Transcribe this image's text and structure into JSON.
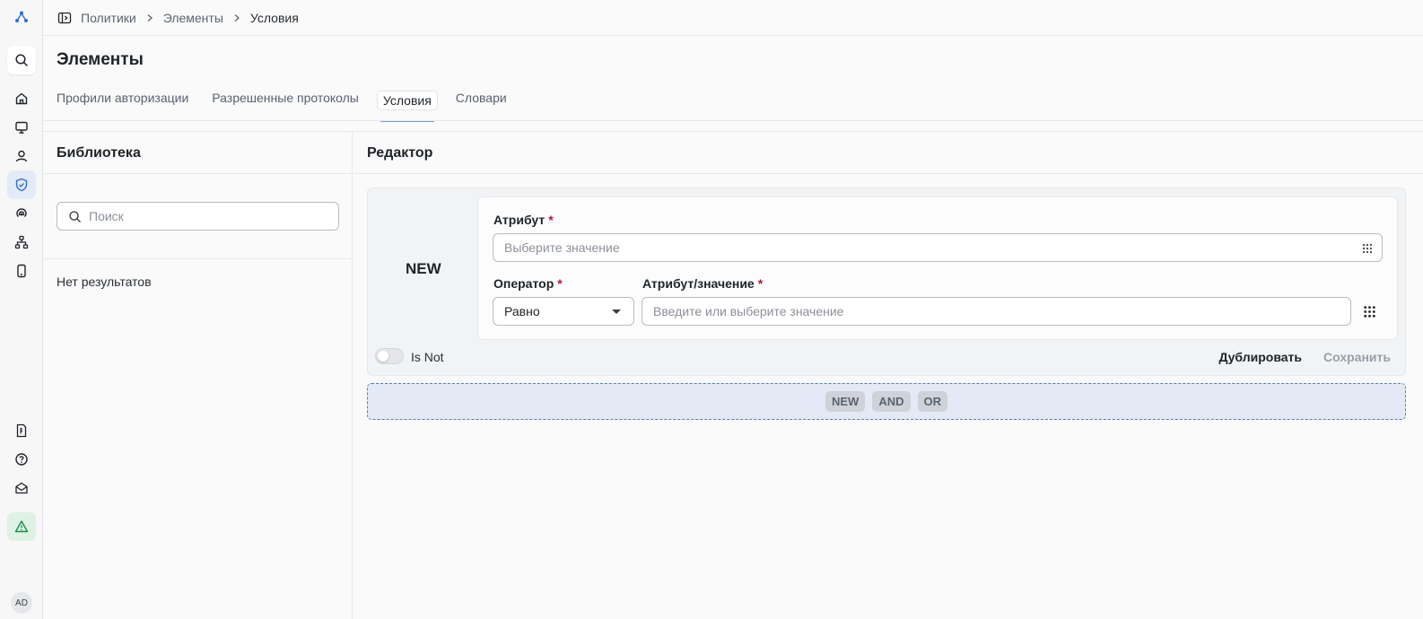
{
  "breadcrumb": [
    "Политики",
    "Элементы",
    "Условия"
  ],
  "page": {
    "title": "Элементы"
  },
  "tabs": [
    {
      "label": "Профили авторизации",
      "active": false
    },
    {
      "label": "Разрешенные протоколы",
      "active": false
    },
    {
      "label": "Условия",
      "active": true
    },
    {
      "label": "Словари",
      "active": false
    }
  ],
  "library": {
    "title": "Библиотека",
    "search_placeholder": "Поиск",
    "empty_text": "Нет результатов"
  },
  "editor": {
    "title": "Редактор",
    "condition_label": "NEW",
    "attribute_label": "Атрибут",
    "attribute_placeholder": "Выберите значение",
    "operator_label": "Оператор",
    "operator_value": "Равно",
    "value_label": "Атрибут/значение",
    "value_placeholder": "Введите или выберите значение",
    "required_mark": "*",
    "is_not_label": "Is Not",
    "is_not_enabled": false,
    "duplicate_label": "Дублировать",
    "save_label": "Сохранить",
    "chips": [
      "NEW",
      "AND",
      "OR"
    ]
  },
  "user": {
    "initials": "AD"
  },
  "colors": {
    "accent": "#2f6fd0",
    "active_tab_underline": "#7f9ed0",
    "required": "#b01a3a",
    "warning_bg": "#ddf2e3",
    "warning_icon": "#1f8a4c"
  },
  "icons": [
    "logo-icon",
    "search-icon",
    "home-icon",
    "monitor-icon",
    "user-icon",
    "shield-check-icon",
    "broadcast-icon",
    "network-icon",
    "mobile-icon",
    "billing-icon",
    "help-icon",
    "mail-icon",
    "alert-icon"
  ]
}
